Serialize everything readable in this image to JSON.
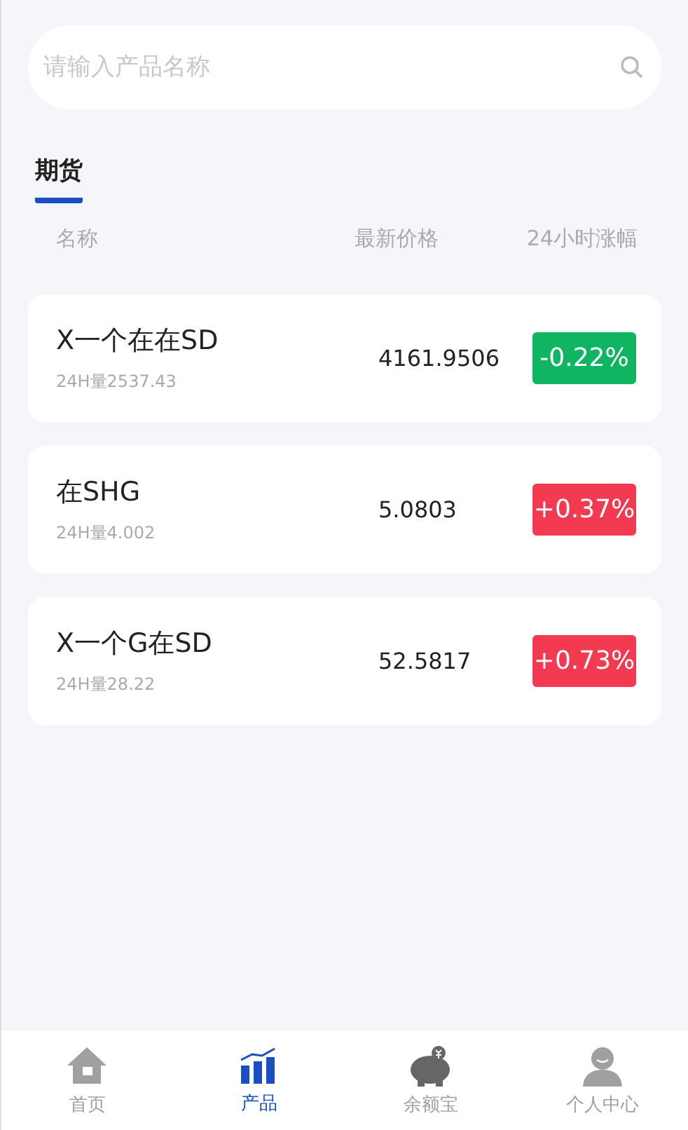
{
  "search": {
    "placeholder": "请输入产品名称"
  },
  "tabs": [
    {
      "label": "期货",
      "selected": true
    }
  ],
  "columns": [
    "名称",
    "最新价格",
    "24小时涨幅"
  ],
  "products": [
    {
      "name": "X一个在在SD",
      "volume": "24H量2537.43",
      "price": "4161.9506",
      "change": "-0.22%",
      "kind": "down"
    },
    {
      "name": "在SHG",
      "volume": "24H量4.002",
      "price": "5.0803",
      "change": "+0.37%",
      "kind": "up"
    },
    {
      "name": "X一个G在SD",
      "volume": "24H量28.22",
      "price": "52.5817",
      "change": "+0.73%",
      "kind": "up"
    }
  ],
  "nav": [
    {
      "label": "首页",
      "selected": false
    },
    {
      "label": "产品",
      "selected": true
    },
    {
      "label": "余额宝",
      "selected": false
    },
    {
      "label": "个人中心",
      "selected": false
    }
  ]
}
